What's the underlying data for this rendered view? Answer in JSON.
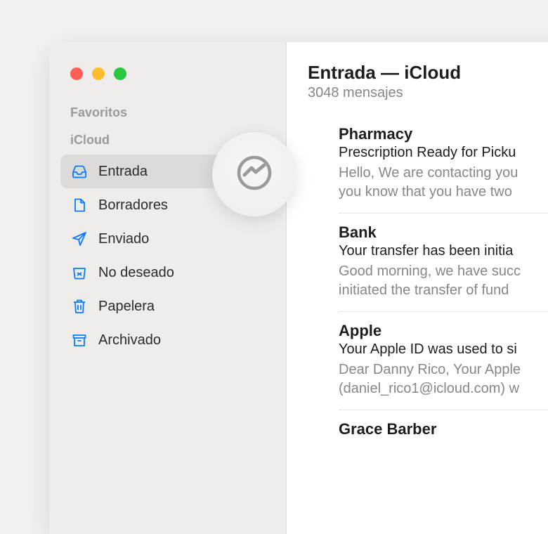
{
  "sidebar": {
    "favorites_label": "Favoritos",
    "account_label": "iCloud",
    "items": [
      {
        "label": "Entrada"
      },
      {
        "label": "Borradores"
      },
      {
        "label": "Enviado"
      },
      {
        "label": "No deseado"
      },
      {
        "label": "Papelera"
      },
      {
        "label": "Archivado"
      }
    ]
  },
  "header": {
    "title": "Entrada — iCloud",
    "subtitle": "3048 mensajes"
  },
  "messages": [
    {
      "from": "Pharmacy",
      "subject": "Prescription Ready for Picku",
      "preview": "Hello, We are contacting you\nyou know that you have two"
    },
    {
      "from": "Bank",
      "subject": "Your transfer has been initia",
      "preview": "Good morning, we have succ\ninitiated the transfer of fund"
    },
    {
      "from": "Apple",
      "subject": "Your Apple ID was used to si",
      "preview": "Dear Danny Rico, Your Apple\n(daniel_rico1@icloud.com) w"
    },
    {
      "from": "Grace Barber",
      "subject": "",
      "preview": ""
    }
  ],
  "floating_icon": "messenger-icon"
}
